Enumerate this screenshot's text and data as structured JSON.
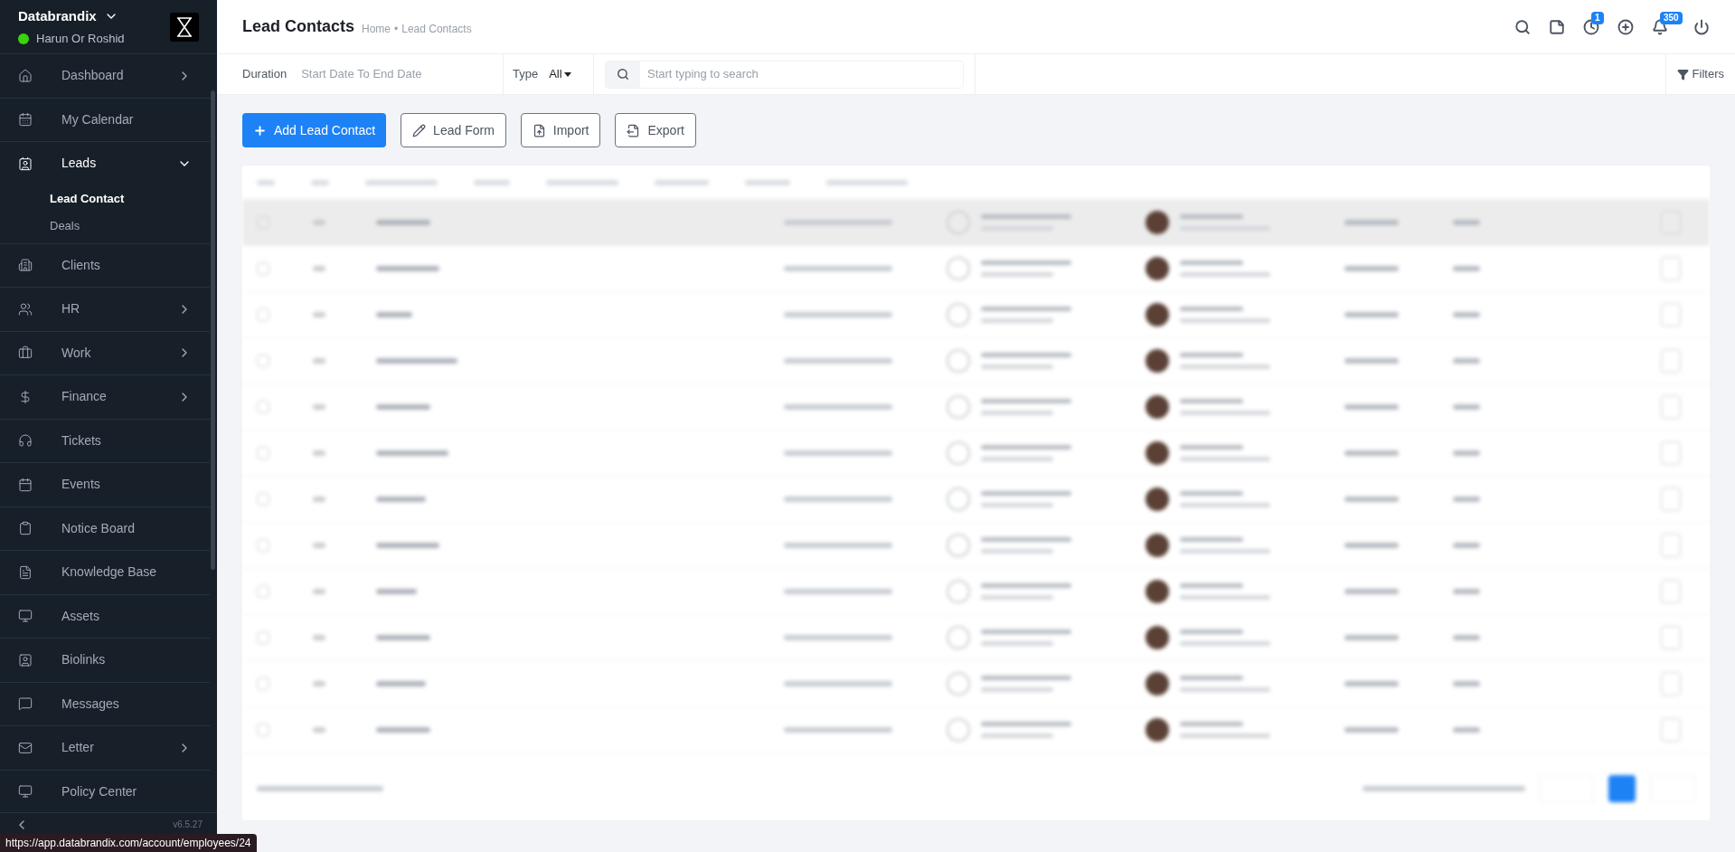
{
  "brand": {
    "name": "Databrandix",
    "user": "Harun Or Roshid",
    "online": true
  },
  "sidebar": {
    "items": [
      {
        "label": "Dashboard",
        "kind": "group",
        "expanded": false,
        "selected": false
      },
      {
        "label": "My Calendar",
        "kind": "link",
        "selected": false
      },
      {
        "label": "Leads",
        "kind": "group",
        "expanded": true,
        "selected": true,
        "children": [
          {
            "label": "Lead Contact",
            "selected": true
          },
          {
            "label": "Deals",
            "selected": false
          }
        ]
      },
      {
        "label": "Clients",
        "kind": "link",
        "selected": false
      },
      {
        "label": "HR",
        "kind": "group",
        "expanded": false,
        "selected": false
      },
      {
        "label": "Work",
        "kind": "group",
        "expanded": false,
        "selected": false
      },
      {
        "label": "Finance",
        "kind": "group",
        "expanded": false,
        "selected": false
      },
      {
        "label": "Tickets",
        "kind": "link",
        "selected": false
      },
      {
        "label": "Events",
        "kind": "link",
        "selected": false
      },
      {
        "label": "Notice Board",
        "kind": "link",
        "selected": false
      },
      {
        "label": "Knowledge Base",
        "kind": "link",
        "selected": false
      },
      {
        "label": "Assets",
        "kind": "link",
        "selected": false
      },
      {
        "label": "Biolinks",
        "kind": "link",
        "selected": false
      },
      {
        "label": "Messages",
        "kind": "link",
        "selected": false
      },
      {
        "label": "Letter",
        "kind": "group",
        "expanded": false,
        "selected": false
      },
      {
        "label": "Policy Center",
        "kind": "link",
        "selected": false
      }
    ],
    "version": "v6.5.27"
  },
  "header": {
    "title": "Lead Contacts",
    "breadcrumb": {
      "items": [
        "Home",
        "Lead Contacts"
      ],
      "separator": "•"
    },
    "badges": {
      "clock": "1",
      "bell": "350"
    }
  },
  "filters": {
    "duration_label": "Duration",
    "duration_placeholder": "Start Date To End Date",
    "type_label": "Type",
    "type_value": "All",
    "search_placeholder": "Start typing to search",
    "filters_button": "Filters"
  },
  "actions": [
    "Add Lead Contact",
    "Lead Form",
    "Import",
    "Export"
  ],
  "status_url": "https://app.databrandix.com/account/employees/24"
}
